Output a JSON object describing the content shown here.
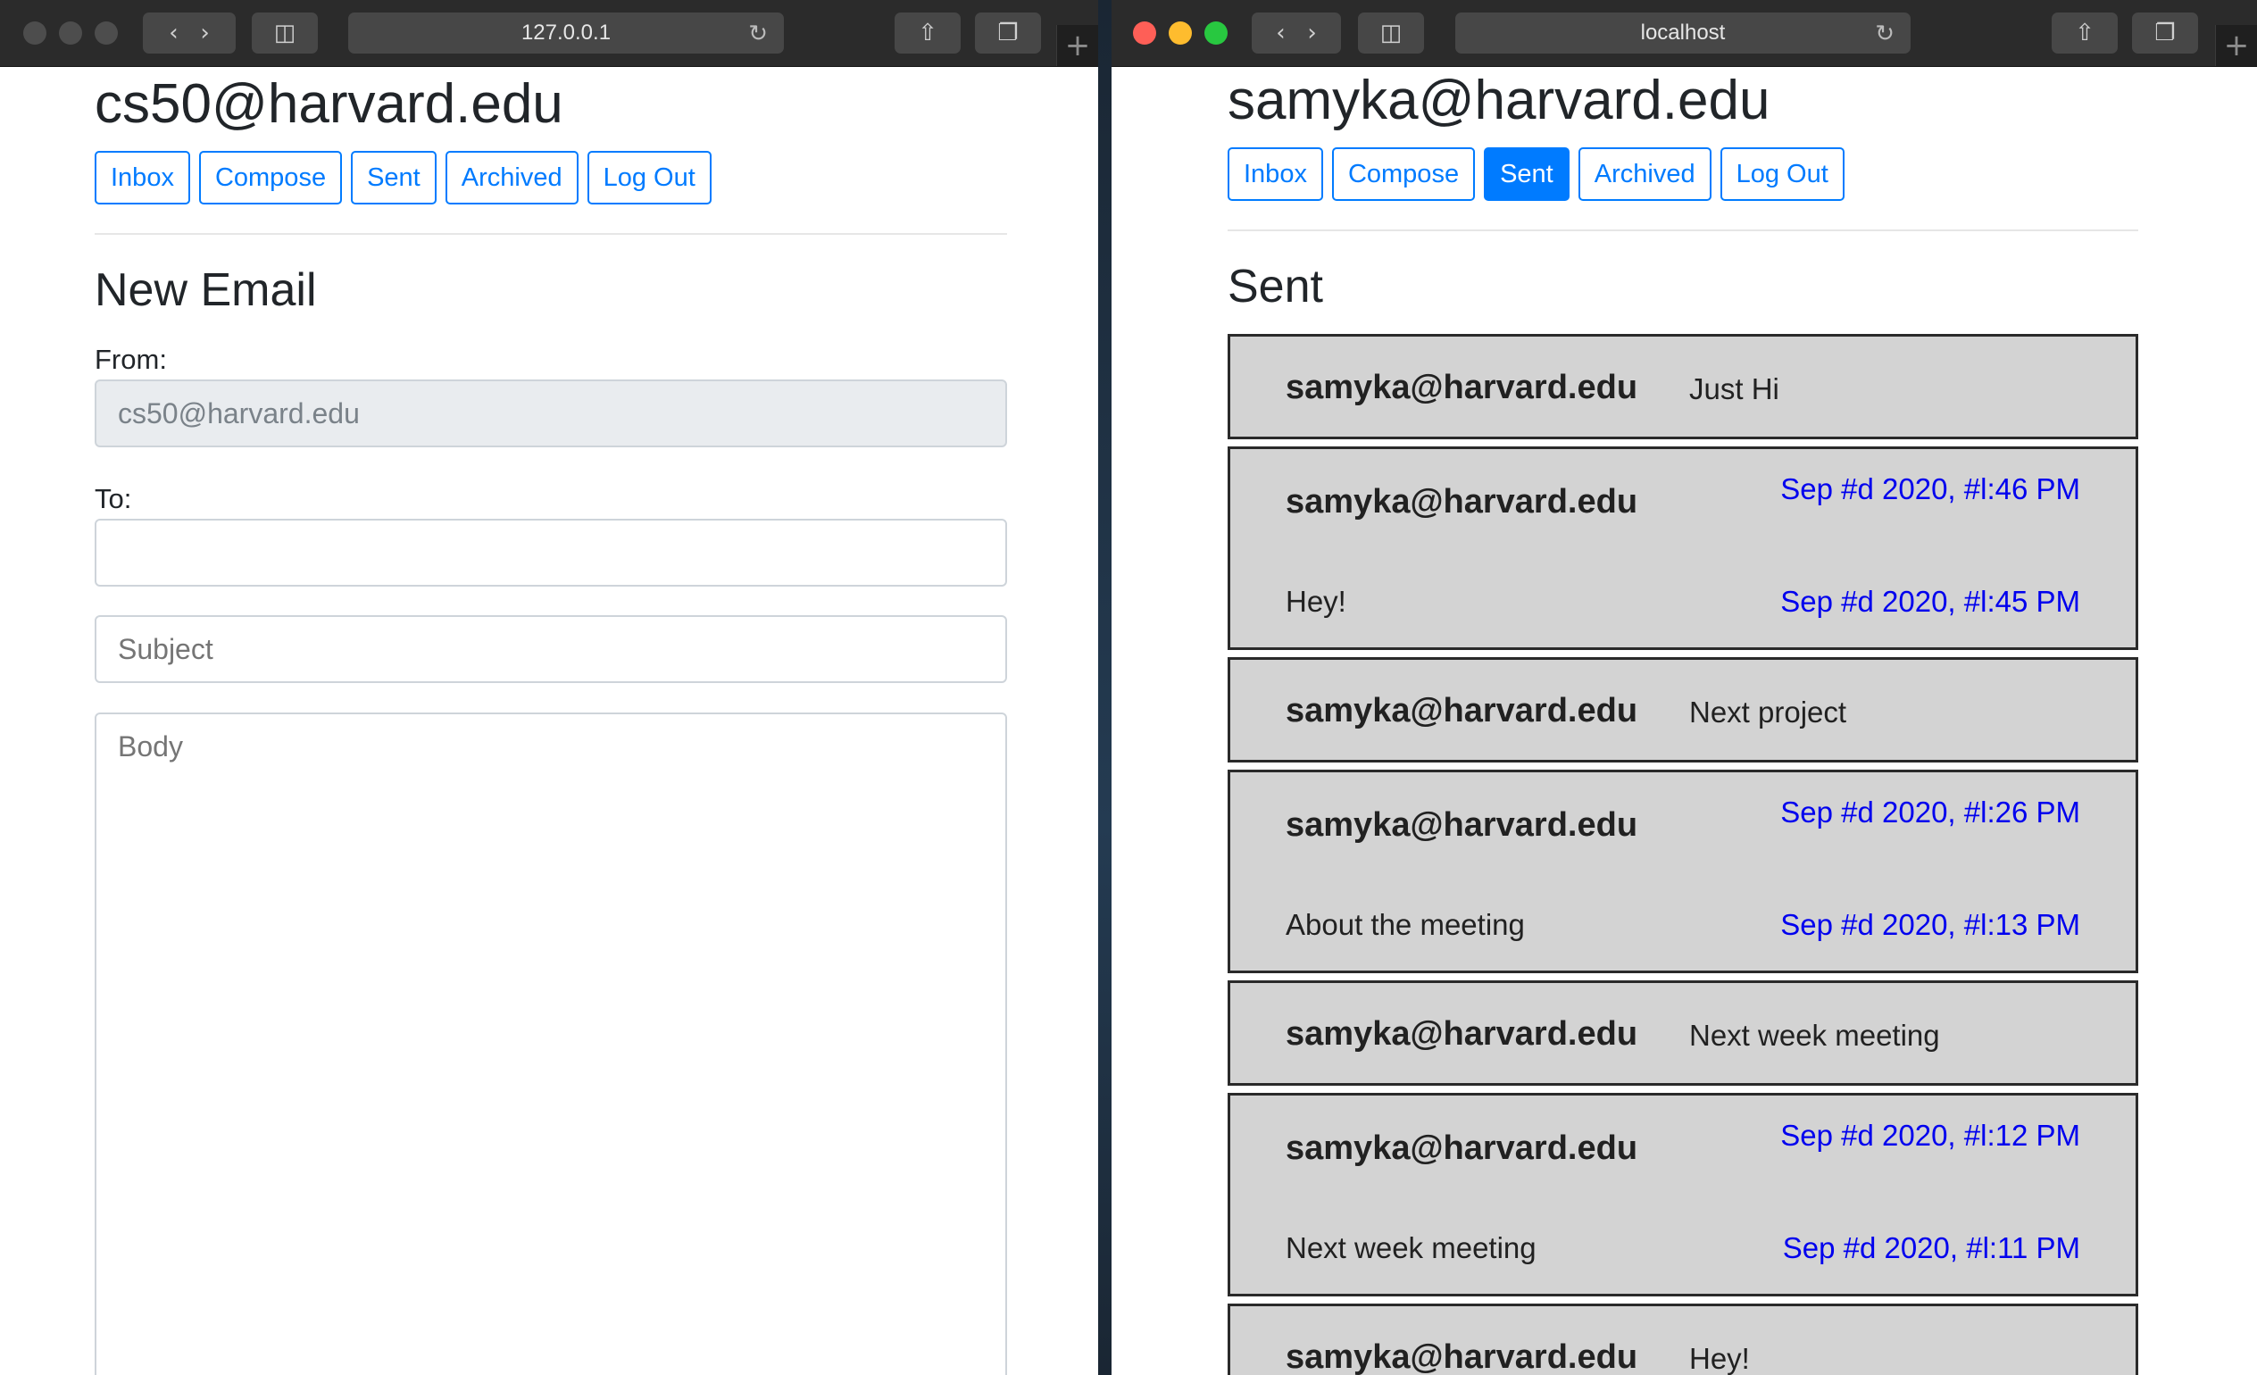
{
  "left_window": {
    "address": "127.0.0.1",
    "user": "cs50@harvard.edu",
    "nav": [
      "Inbox",
      "Compose",
      "Sent",
      "Archived",
      "Log Out"
    ],
    "heading": "New Email",
    "from_label": "From:",
    "from_value": "cs50@harvard.edu",
    "to_label": "To:",
    "to_value": "",
    "subject_placeholder": "Subject",
    "body_placeholder": "Body"
  },
  "right_window": {
    "address": "localhost",
    "user": "samyka@harvard.edu",
    "nav": [
      "Inbox",
      "Compose",
      "Sent",
      "Archived",
      "Log Out"
    ],
    "active_nav": "Sent",
    "heading": "Sent",
    "emails": [
      {
        "sender": "samyka@harvard.edu",
        "subject": "Just Hi"
      },
      {
        "sender": "samyka@harvard.edu",
        "timestamp": "Sep #d 2020, #l:46 PM",
        "subject": "Hey!",
        "timestamp2": "Sep #d 2020, #l:45 PM"
      },
      {
        "sender": "samyka@harvard.edu",
        "subject": "Next project"
      },
      {
        "sender": "samyka@harvard.edu",
        "timestamp": "Sep #d 2020, #l:26 PM",
        "subject": "About the meeting",
        "timestamp2": "Sep #d 2020, #l:13 PM"
      },
      {
        "sender": "samyka@harvard.edu",
        "subject": "Next week meeting"
      },
      {
        "sender": "samyka@harvard.edu",
        "timestamp": "Sep #d 2020, #l:12 PM",
        "subject": "Next week meeting",
        "timestamp2": "Sep #d 2020, #l:11 PM"
      },
      {
        "sender": "samyka@harvard.edu",
        "subject": "Hey!"
      }
    ]
  },
  "colors": {
    "link": "#007bff",
    "timestamp": "#0000ee",
    "email_bg": "#d3d3d3"
  },
  "icons": [
    "back-icon",
    "forward-icon",
    "sidebar-icon",
    "reload-icon",
    "share-icon",
    "tabs-icon",
    "new-tab-icon"
  ]
}
